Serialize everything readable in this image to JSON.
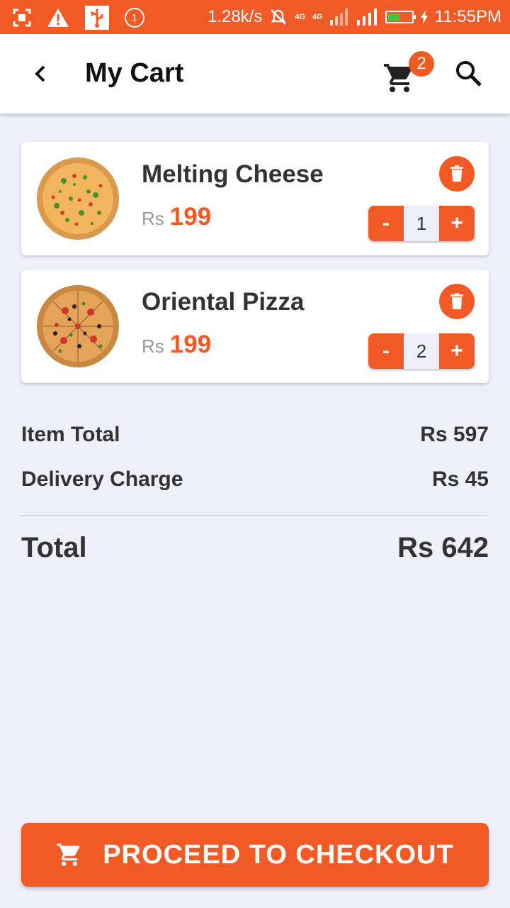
{
  "status_bar": {
    "net_speed": "1.28k/s",
    "net_type_1": "4G",
    "net_type_2": "4G",
    "time": "11:55PM",
    "notification_count": "1",
    "battery_level": 0.45,
    "battery_color": "#3ec93e"
  },
  "header": {
    "title": "My Cart",
    "cart_count": "2",
    "icons": [
      "back-arrow-icon",
      "cart-icon",
      "search-icon"
    ]
  },
  "cart_items": [
    {
      "name": "Melting Cheese",
      "currency": "Rs",
      "price": "199",
      "quantity": "1",
      "minus_label": "-",
      "plus_label": "+",
      "image": "pizza-cheese-image"
    },
    {
      "name": "Oriental Pizza",
      "currency": "Rs",
      "price": "199",
      "quantity": "2",
      "minus_label": "-",
      "plus_label": "+",
      "image": "pizza-oriental-image"
    }
  ],
  "summary": {
    "item_total_label": "Item Total",
    "item_total_value": "Rs 597",
    "delivery_label": "Delivery Charge",
    "delivery_value": "Rs 45",
    "total_label": "Total",
    "total_value": "Rs 642"
  },
  "checkout": {
    "label": "PROCEED TO CHECKOUT"
  },
  "colors": {
    "accent": "#f15a24",
    "background": "#eeeff8",
    "text": "#333333"
  }
}
